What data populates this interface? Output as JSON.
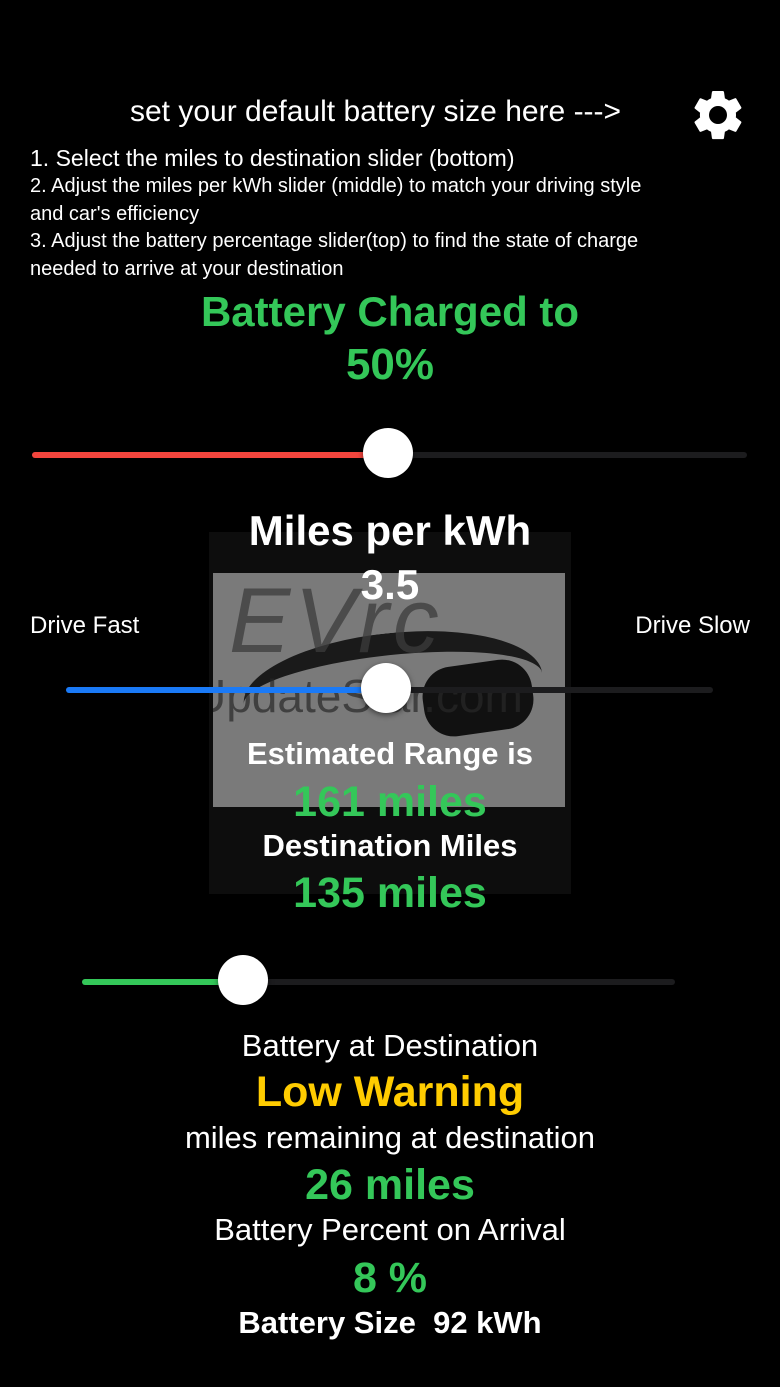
{
  "header": {
    "hint": "set your default battery size here --->",
    "settings_icon": "gear-icon"
  },
  "instructions": {
    "step1": "1. Select the miles to destination slider (bottom)",
    "step2_line1": "2. Adjust the miles per kWh slider (middle) to match your driving style",
    "step2_line2": "and car's efficiency",
    "step3_line1": "3. Adjust the battery percentage slider(top) to find the state of charge",
    "step3_line2": "needed to arrive at your destination"
  },
  "battery_charge": {
    "label": "Battery Charged to",
    "value": "50%",
    "slider_fraction": 0.498,
    "color": "#f2453d"
  },
  "efficiency": {
    "label": "Miles per kWh",
    "value": "3.5",
    "left_label": "Drive Fast",
    "right_label": "Drive Slow",
    "slider_fraction": 0.495,
    "color": "#1a7af7"
  },
  "watermark": {
    "text_large": "EVrc",
    "text_small": "UpdateStar.com"
  },
  "range": {
    "label": "Estimated Range is",
    "value": "161 miles"
  },
  "destination": {
    "label": "Destination Miles",
    "value": "135 miles",
    "slider_fraction": 0.272,
    "color": "#34c759"
  },
  "arrival": {
    "battery_label": "Battery at Destination",
    "battery_status": "Low Warning",
    "battery_status_color": "#ffcc00",
    "remaining_label": "miles remaining at destination",
    "remaining_value": "26 miles",
    "percent_label": "Battery Percent on Arrival",
    "percent_value": "8 %",
    "size_label": "Battery Size",
    "size_value": "92 kWh"
  }
}
